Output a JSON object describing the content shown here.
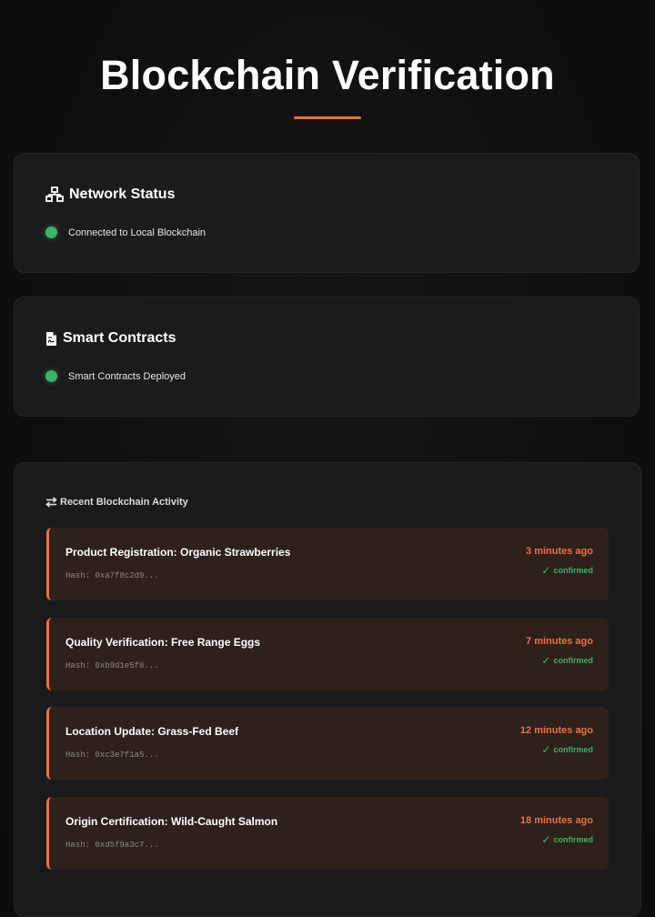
{
  "page": {
    "title": "Blockchain Verification"
  },
  "network": {
    "heading": "Network Status",
    "icon": "network-icon",
    "status_text": "Connected to Local Blockchain",
    "status_color": "#3bb26a"
  },
  "contracts": {
    "heading": "Smart Contracts",
    "icon": "contract-file-icon",
    "status_text": "Smart Contracts Deployed",
    "status_color": "#3bb26a"
  },
  "activity": {
    "heading": "Recent Blockchain Activity",
    "icon": "exchange-arrows-icon",
    "items": [
      {
        "title": "Product Registration: Organic Strawberries",
        "hash": "Hash: 0xa7f8c2d9...",
        "time": "3 minutes ago",
        "status": "confirmed"
      },
      {
        "title": "Quality Verification: Free Range Eggs",
        "hash": "Hash: 0xb9d1e5f8...",
        "time": "7 minutes ago",
        "status": "confirmed"
      },
      {
        "title": "Location Update: Grass-Fed Beef",
        "hash": "Hash: 0xc3e7f1a5...",
        "time": "12 minutes ago",
        "status": "confirmed"
      },
      {
        "title": "Origin Certification: Wild-Caught Salmon",
        "hash": "Hash: 0xd5f9a3c7...",
        "time": "18 minutes ago",
        "status": "confirmed"
      }
    ]
  },
  "colors": {
    "accent": "#f07040",
    "success": "#3bb26a",
    "background": "#111111",
    "card": "#1b1b1b",
    "activity_item": "#2e201b"
  }
}
